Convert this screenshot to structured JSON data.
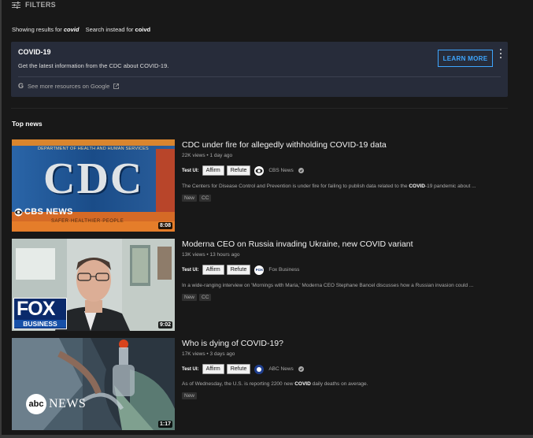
{
  "filters": {
    "label": "FILTERS",
    "icon": "sliders-icon"
  },
  "query": {
    "prefix": "Showing results for",
    "corrected": "covid",
    "instead_prefix": "Search instead for",
    "original": "coivd"
  },
  "info_panel": {
    "title": "COVID-19",
    "text": "Get the latest information from the CDC about COVID-19.",
    "button": "LEARN MORE",
    "more_link": "See more resources on Google",
    "accent": "#3ea6ff"
  },
  "section_title": "Top news",
  "videos": [
    {
      "title": "CDC under fire for allegedly withholding COVID-19 data",
      "meta": "22K views • 1 day ago",
      "test_label": "Test UI:",
      "affirm": "Affirm",
      "refute": "Refute",
      "channel": "CBS News",
      "desc_pre": "The Centers for Disease Control and Prevention is under fire for failing to publish data related to the ",
      "desc_bold": "COVID",
      "desc_post": "-19 pandemic about ...",
      "badges": [
        "New",
        "CC"
      ],
      "duration": "8:08",
      "thumb_text": {
        "header": "DEPARTMENT OF HEALTH AND HUMAN SERVICES",
        "big": "CDC",
        "logo": "CBS NEWS",
        "footer": "SAFER·HEALTHIER·PEOPLE"
      }
    },
    {
      "title": "Moderna CEO on Russia invading Ukraine, new COVID variant",
      "meta": "13K views • 13 hours ago",
      "test_label": "Test UI:",
      "affirm": "Affirm",
      "refute": "Refute",
      "channel": "Fox Business",
      "channel_icon_text": "FOX",
      "desc_pre": "In a wide-ranging interview on 'Mornings with Maria,' Moderna CEO Stephane Bancel discusses how a Russian invasion could ...",
      "desc_bold": "",
      "desc_post": "",
      "badges": [
        "New",
        "CC"
      ],
      "duration": "9:02",
      "thumb_text": {
        "logo_top": "FOX",
        "logo_bottom": "BUSINESS"
      }
    },
    {
      "title": "Who is dying of COVID-19?",
      "meta": "17K views • 3 days ago",
      "test_label": "Test UI:",
      "affirm": "Affirm",
      "refute": "Refute",
      "channel": "ABC News",
      "desc_pre": "As of Wednesday, the U.S. is reporting 2200 new ",
      "desc_bold": "COVID",
      "desc_post": " daily deaths on average.",
      "badges": [
        "New"
      ],
      "duration": "1:17",
      "thumb_text": {
        "logo_small": "abc",
        "logo": "NEWS"
      }
    }
  ]
}
